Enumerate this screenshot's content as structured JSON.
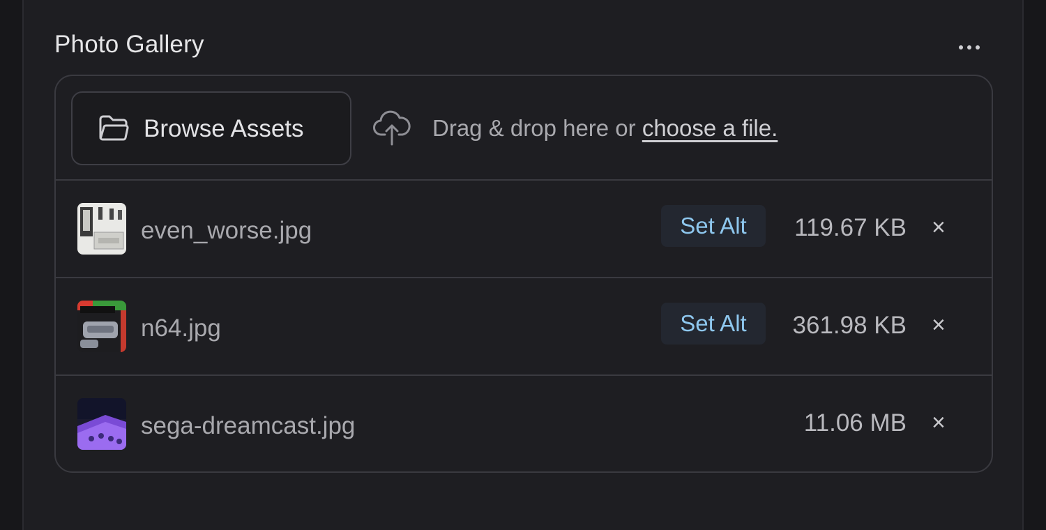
{
  "panel": {
    "title": "Photo Gallery",
    "more_icon": "more-horizontal-icon"
  },
  "upload": {
    "browse_label": "Browse Assets",
    "browse_icon": "folder-icon",
    "upload_icon": "cloud-upload-icon",
    "drop_text": "Drag & drop here or ",
    "choose_link": "choose a file."
  },
  "files": [
    {
      "name": "even_worse.jpg",
      "set_alt": "Set Alt",
      "size": "119.67 KB",
      "close": "×"
    },
    {
      "name": "n64.jpg",
      "set_alt": "Set Alt",
      "size": "361.98 KB",
      "close": "×"
    },
    {
      "name": "sega-dreamcast.jpg",
      "size": "11.06 MB",
      "close": "×"
    }
  ],
  "colors": {
    "background": "#17171a",
    "panel": "#1e1e22",
    "border": "#3a3a40",
    "accent": "#8ec7ee"
  }
}
